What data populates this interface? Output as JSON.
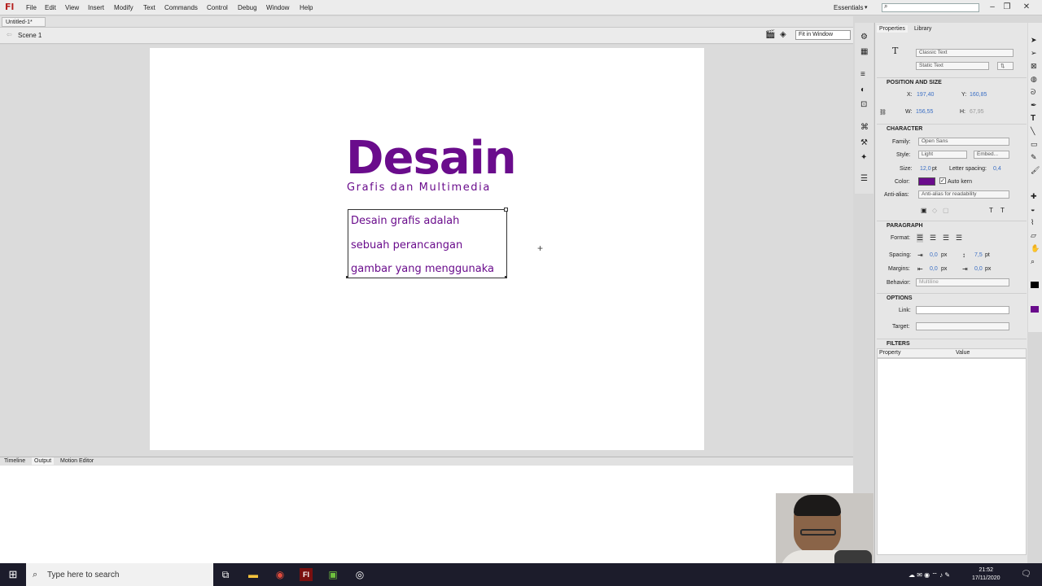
{
  "app": {
    "logo": "Fl"
  },
  "menu": [
    "File",
    "Edit",
    "View",
    "Insert",
    "Modify",
    "Text",
    "Commands",
    "Control",
    "Debug",
    "Window",
    "Help"
  ],
  "workspace": "Essentials",
  "document": {
    "tab": "Untitled-1*",
    "scene": "Scene 1",
    "zoom": "Fit in Window"
  },
  "stage": {
    "title": "Desain",
    "subtitle": "Grafis dan Multimedia",
    "text_lines": [
      "Desain grafis adalah",
      "sebuah perancangan",
      "gambar yang menggunaka"
    ],
    "accent": "#6a0c8c"
  },
  "bottom_tabs": [
    "Timeline",
    "Output",
    "Motion Editor"
  ],
  "panel": {
    "tabs": [
      "Properties",
      "Library"
    ],
    "text_engine": "Classic Text",
    "text_type": "Static Text",
    "position_size": {
      "header": "POSITION AND SIZE",
      "x_label": "X:",
      "x": "197,40",
      "y_label": "Y:",
      "y": "160,85",
      "w_label": "W:",
      "w": "156,55",
      "h_label": "H:",
      "h": "67,95"
    },
    "character": {
      "header": "CHARACTER",
      "family_label": "Family:",
      "family": "Open Sans",
      "style_label": "Style:",
      "style": "Light",
      "embed": "Embed...",
      "size_label": "Size:",
      "size": "12,0",
      "size_unit": "pt",
      "ls_label": "Letter spacing:",
      "ls": "0,4",
      "color_label": "Color:",
      "auto_kern": "Auto kern",
      "aa_label": "Anti-alias:",
      "aa": "Anti-alias for readability",
      "color": "#6a0c8c"
    },
    "paragraph": {
      "header": "PARAGRAPH",
      "format_label": "Format:",
      "spacing_label": "Spacing:",
      "spacing1": "0,0",
      "spacing1_unit": "px",
      "spacing2": "7,5",
      "spacing2_unit": "pt",
      "margins_label": "Margins:",
      "margin1": "0,0",
      "margin1_unit": "px",
      "margin2": "0,0",
      "margin2_unit": "px",
      "behavior_label": "Behavior:",
      "behavior": "Multiline"
    },
    "options": {
      "header": "OPTIONS",
      "link_label": "Link:",
      "target_label": "Target:"
    },
    "filters": {
      "header": "FILTERS",
      "col1": "Property",
      "col2": "Value"
    }
  },
  "taskbar": {
    "search_placeholder": "Type here to search",
    "time": "21:52",
    "date": "17/11/2020"
  }
}
